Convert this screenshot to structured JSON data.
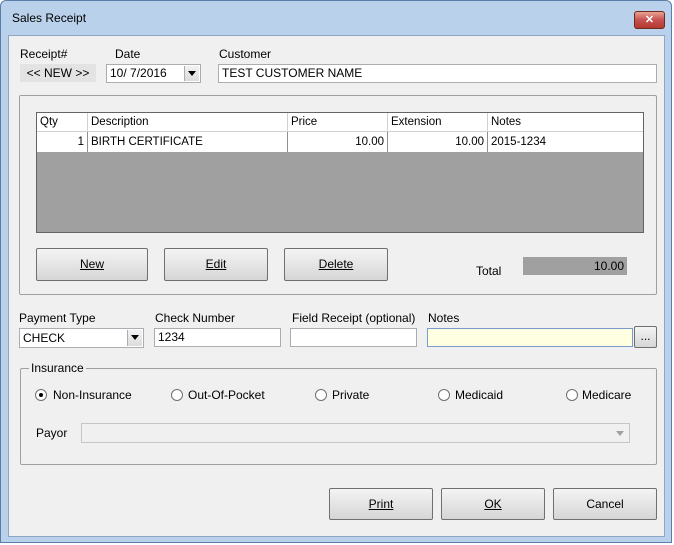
{
  "window": {
    "title": "Sales Receipt",
    "close_glyph": "✕"
  },
  "header": {
    "receipt_label": "Receipt#",
    "receipt_value": "<< NEW >>",
    "date_label": "Date",
    "date_value": "10/  7/2016",
    "customer_label": "Customer",
    "customer_value": "TEST CUSTOMER NAME"
  },
  "grid": {
    "columns": [
      "Qty",
      "Description",
      "Price",
      "Extension",
      "Notes"
    ],
    "rows": [
      {
        "qty": "1",
        "description": "BIRTH CERTIFICATE",
        "price": "10.00",
        "extension": "10.00",
        "notes": "2015-1234"
      }
    ]
  },
  "item_buttons": {
    "new": "New",
    "edit": "Edit",
    "delete": "Delete"
  },
  "total": {
    "label": "Total",
    "value": "10.00"
  },
  "payment": {
    "type_label": "Payment Type",
    "type_value": "CHECK",
    "check_label": "Check Number",
    "check_value": "1234",
    "field_receipt_label": "Field Receipt (optional)",
    "field_receipt_value": "",
    "notes_label": "Notes",
    "notes_value": "",
    "browse_label": "..."
  },
  "insurance": {
    "group_label": "Insurance",
    "options": [
      "Non-Insurance",
      "Out-Of-Pocket",
      "Private",
      "Medicaid",
      "Medicare"
    ],
    "selected": "Non-Insurance",
    "payor_label": "Payor",
    "payor_value": ""
  },
  "footer_buttons": {
    "print": "Print",
    "ok": "OK",
    "cancel": "Cancel"
  },
  "colors": {
    "titlebar": "#b9d1ea",
    "close": "#c75050",
    "notes_bg": "#ffffe1",
    "total_bg": "#a0a0a0",
    "grid_bg": "#a0a0a0"
  }
}
